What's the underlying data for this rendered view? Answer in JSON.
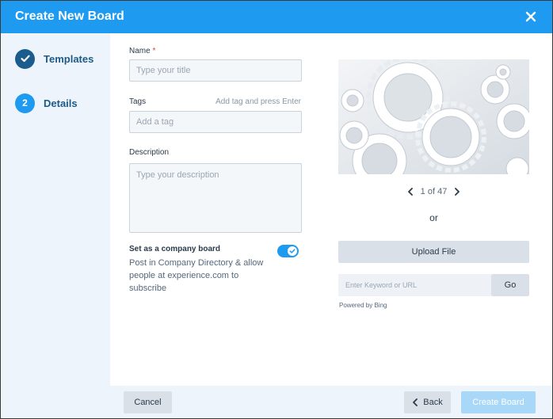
{
  "dialog": {
    "title": "Create New Board",
    "close_icon": "close-icon"
  },
  "steps": [
    {
      "label": "Templates",
      "state": "done",
      "icon": "check-icon"
    },
    {
      "label": "Details",
      "state": "active",
      "number": "2"
    }
  ],
  "form": {
    "name": {
      "label": "Name",
      "required_mark": "*",
      "placeholder": "Type your title",
      "value": ""
    },
    "tags": {
      "label": "Tags",
      "hint": "Add tag and press Enter",
      "placeholder": "Add a tag",
      "value": ""
    },
    "description": {
      "label": "Description",
      "placeholder": "Type your description",
      "value": ""
    },
    "company_board": {
      "title": "Set as a company board",
      "description": "Post in Company Directory & allow people at experience.com to subscribe",
      "enabled": true
    }
  },
  "image_picker": {
    "pager_text": "1 of 47",
    "prev_icon": "chevron-left-icon",
    "next_icon": "chevron-right-icon",
    "or_text": "or",
    "upload_label": "Upload File",
    "search_placeholder": "Enter Keyword or URL",
    "go_label": "Go",
    "powered_by": "Powered by Bing"
  },
  "footer": {
    "cancel_label": "Cancel",
    "back_label": "Back",
    "create_label": "Create Board"
  },
  "colors": {
    "accent": "#1e9bf0",
    "step_done": "#1b5c8e",
    "sidebar_bg": "#eef4fb",
    "button_bg": "#d9e0e8",
    "primary_disabled": "#a9d7f7"
  }
}
